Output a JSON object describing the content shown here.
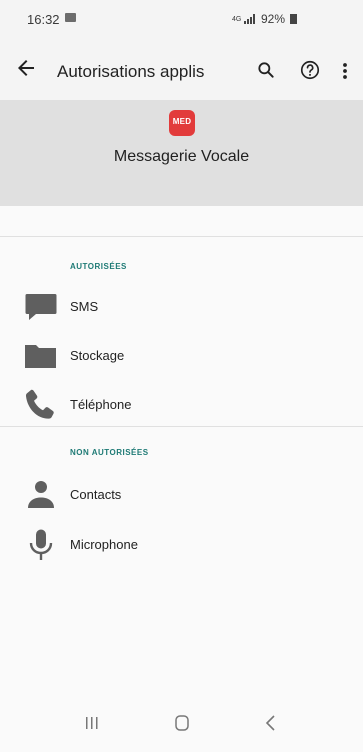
{
  "status": {
    "time": "16:32",
    "network": "4G",
    "battery": "92%"
  },
  "appbar": {
    "title": "Autorisations applis"
  },
  "app": {
    "name": "Messagerie Vocale",
    "icon_text": "MED",
    "icon_color": "#e23b3b"
  },
  "sections": {
    "allowed": {
      "title": "AUTORISÉES",
      "items": [
        "SMS",
        "Stockage",
        "Téléphone"
      ]
    },
    "denied": {
      "title": "NON AUTORISÉES",
      "items": [
        "Contacts",
        "Microphone"
      ]
    }
  },
  "colors": {
    "section_title": "#1e7a75",
    "icon_gray": "#5f5f5f"
  }
}
